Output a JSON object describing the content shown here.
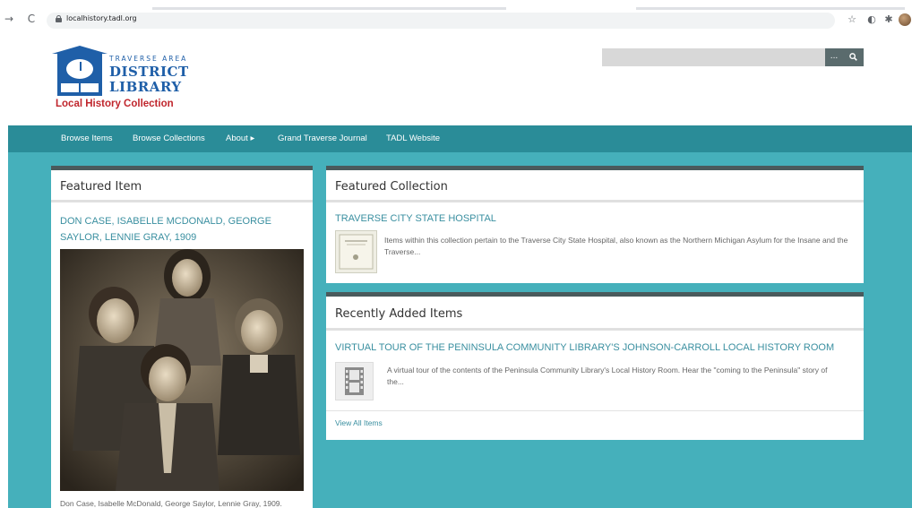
{
  "browser": {
    "url": "localhistory.tadl.org",
    "icons": [
      "back-icon",
      "reload-icon",
      "lock-icon",
      "star-icon",
      "extension-icon",
      "puzzle-icon",
      "profile-icon"
    ]
  },
  "logo": {
    "line1": "TRAVERSE AREA",
    "line2": "DISTRICT",
    "line3": "LIBRARY",
    "tagline": "Local History Collection"
  },
  "search": {
    "placeholder": "",
    "options_label": "...",
    "button_icon": "search-icon"
  },
  "nav": {
    "items": [
      {
        "label": "Browse Items"
      },
      {
        "label": "Browse Collections"
      },
      {
        "label": "About ▸"
      },
      {
        "label": "Grand Traverse Journal"
      },
      {
        "label": "TADL Website"
      }
    ]
  },
  "featured_item": {
    "heading": "Featured Item",
    "title": "DON CASE, ISABELLE MCDONALD, GEORGE SAYLOR, LENNIE GRAY, 1909",
    "caption": "Don Case, Isabelle McDonald, George Saylor, Lennie Gray, 1909."
  },
  "featured_collection": {
    "heading": "Featured Collection",
    "title": "TRAVERSE CITY STATE HOSPITAL",
    "description": "Items within this collection pertain to the Traverse City State Hospital, also known as the Northern Michigan Asylum for the Insane and the Traverse..."
  },
  "recent": {
    "heading": "Recently Added Items",
    "title": "VIRTUAL TOUR OF THE PENINSULA COMMUNITY LIBRARY'S JOHNSON-CARROLL LOCAL HISTORY ROOM",
    "description": "A virtual tour of the contents of the Peninsula Community Library's Local History Room. Hear the \"coming to the Peninsula\" story of the...",
    "view_all": "View All Items"
  },
  "colors": {
    "teal_nav": "#2a8c98",
    "teal_bg": "#45b0bb",
    "link": "#3a8fa0",
    "brand_blue": "#1f5fa8",
    "brand_red": "#c0262d"
  }
}
